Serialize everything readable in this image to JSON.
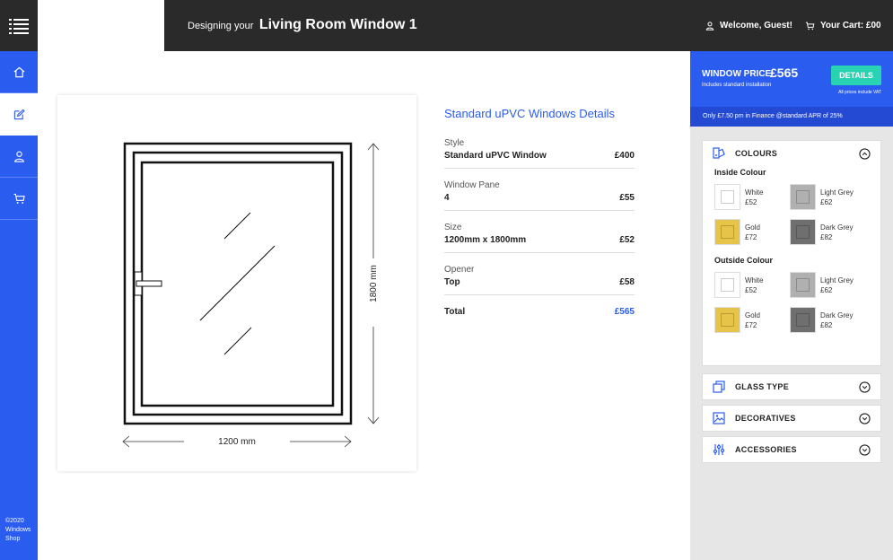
{
  "header": {
    "title_prefix": "Designing your",
    "title_main": "Living Room Window 1",
    "welcome": "Welcome, Guest!",
    "cart": "Your Cart: £00"
  },
  "sidebar": {
    "items": [
      {
        "icon": "home-icon"
      },
      {
        "icon": "edit-icon"
      },
      {
        "icon": "user-icon"
      },
      {
        "icon": "cart-icon"
      }
    ],
    "copyright": "©2020 Windows Shop"
  },
  "drawing": {
    "height_label": "1800 mm",
    "width_label": "1200 mm"
  },
  "details": {
    "title": "Standard uPVC Windows Details",
    "rows": [
      {
        "label": "Style",
        "value": "Standard uPVC Window",
        "price": "£400"
      },
      {
        "label": "Window Pane",
        "value": "4",
        "price": "£55"
      },
      {
        "label": "Size",
        "value": "1200mm x 1800mm",
        "price": "£52"
      },
      {
        "label": "Opener",
        "value": "Top",
        "price": "£58"
      }
    ],
    "total_label": "Total",
    "total_value": "£565"
  },
  "price_box": {
    "label": "WINDOW PRICE",
    "amount": "£565",
    "sub": "Includes standard installation",
    "button": "DETAILS",
    "vat": "All prices include VAT",
    "finance": "Only £7.50 pm in Finance @standard APR of 25%"
  },
  "options": {
    "colours": {
      "title": "COLOURS",
      "inside_title": "Inside Colour",
      "outside_title": "Outside Colour",
      "inside": [
        {
          "name": "White",
          "price": "£52",
          "color": "#ffffff"
        },
        {
          "name": "Light Grey",
          "price": "£62",
          "color": "#b0b0b0"
        },
        {
          "name": "Gold",
          "price": "£72",
          "color": "#e6c349"
        },
        {
          "name": "Dark Grey",
          "price": "£82",
          "color": "#6f6f6f"
        }
      ],
      "outside": [
        {
          "name": "White",
          "price": "£52",
          "color": "#ffffff"
        },
        {
          "name": "Light Grey",
          "price": "£62",
          "color": "#b0b0b0"
        },
        {
          "name": "Gold",
          "price": "£72",
          "color": "#e6c349"
        },
        {
          "name": "Dark Grey",
          "price": "£82",
          "color": "#6f6f6f"
        }
      ]
    },
    "glass_type": "GLASS TYPE",
    "decoratives": "DECORATIVES",
    "accessories": "ACCESSORIES"
  },
  "colors": {
    "accent": "#2b5cf0",
    "dark": "#2a2a2a",
    "teal": "#27d3b2"
  }
}
